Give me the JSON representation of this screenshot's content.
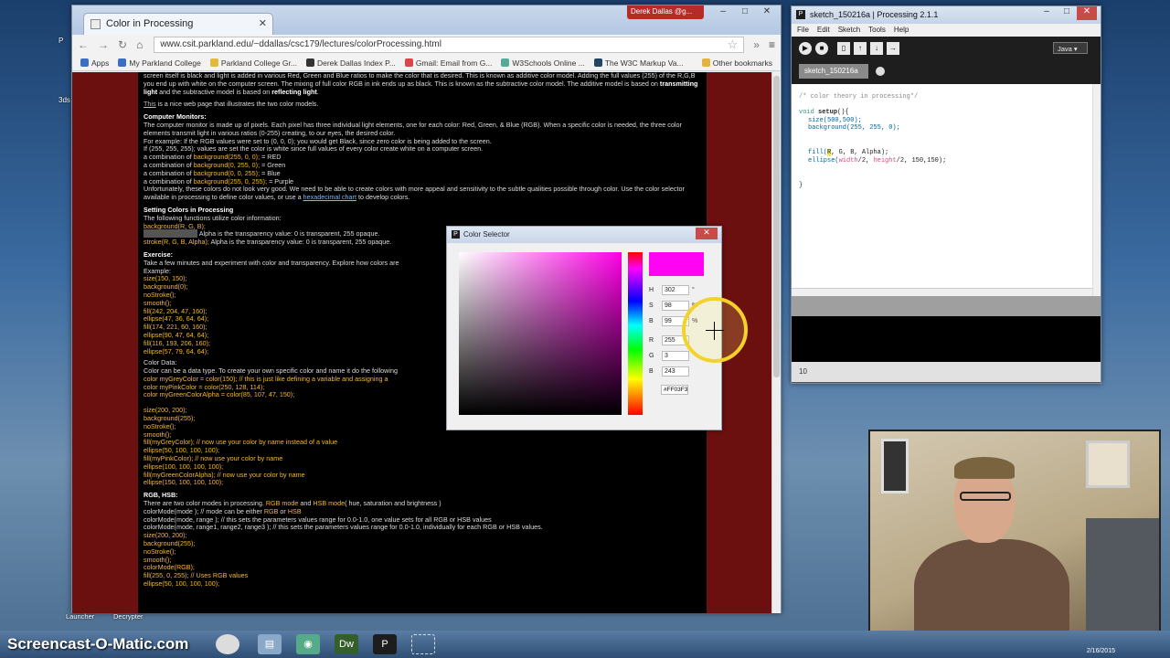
{
  "browser": {
    "tab_title": "Color in Processing",
    "user_chip": "Derek Dallas @g...",
    "url": "www.csit.parkland.edu/~ddallas/csc179/lectures/colorProcessing.html",
    "bookmarks": [
      "Apps",
      "My Parkland College",
      "Parkland College Gr...",
      "Derek Dallas Index P...",
      "Gmail: Email from G...",
      "W3Schools Online ...",
      "The W3C Markup Va..."
    ],
    "other_bookmarks": "Other bookmarks"
  },
  "page": {
    "intro1": "screen itself is black and light is added in various Red, Green and Blue ratios to make the color that is desired. This is known as additive color model. Adding the full values (255) of the R,G,B you end up with white on the computer screen. The mixing of full color RGB in ink ends up as black. This is known as the subtractive color model. The additive model is based on",
    "intro_b1": "transmitting light",
    "intro_mid": "and the subtractive model is based on",
    "intro_b2": "reflecting light",
    "nice_link": "This",
    "nice_text": "is a nice web page that illustrates the two color models.",
    "monitors_h": "Computer Monitors:",
    "monitors_1": "The computer monitor is made up of pixels. Each pixel has three individual light elements, one for each color: Red, Green, & Blue (RGB). When a specific color is needed, the three color elements transmit light in various ratios (0-255) creating, to our eyes, the desired color.",
    "monitors_2": "For example: If the RGB values were set to (0, 0, 0); you would get Black, since zero color is being added to the screen.",
    "monitors_3": "If (255, 255, 255); values are set the color is white since full values of every color create white on a computer screen.",
    "combos": [
      {
        "pre": "a combination of",
        "code": "background(255, 0, 0);",
        "post": "= RED"
      },
      {
        "pre": "a combination of",
        "code": "background(0, 255, 0);",
        "post": "= Green"
      },
      {
        "pre": "a combination of",
        "code": "background(0, 0, 255);",
        "post": "= Blue"
      },
      {
        "pre": "a combination of",
        "code": "background(255, 0, 255);",
        "post": "= Purple"
      }
    ],
    "unfortunately": "Unfortunately, these colors do not look very good. We need to be able to create colors with more appeal and sensitivity to the subtle qualities possible through color. Use the color selector available in processing to define color values, or use a",
    "hex_link": "hexadecimal chart",
    "unfortunately_end": "to develop colors.",
    "setting_h": "Setting Colors in Processing",
    "setting_1": "The following functions utilize color information:",
    "setting_code1": "background(R, G, B);",
    "setting_alpha": "Alpha is the transparency value: 0 is transparent, 255 opaque.",
    "setting_code2": "stroke(R, G, B, Alpha);",
    "setting_alpha2": "Alpha is the transparency value: 0 is transparent, 255 opaque.",
    "exercise_h": "Exercise:",
    "exercise_1": "Take a few minutes and experiment with color and transparency. Explore how colors are",
    "example": "Example:",
    "ex_code": [
      "size(150, 150);",
      "background(0);",
      "noStroke();",
      "smooth();",
      "fill(242, 204, 47, 160);",
      "ellipse(47, 36, 64, 64);",
      "fill(174, 221, 60, 160);",
      "ellipse(90, 47, 64, 64);",
      "fill(116, 193, 206, 160);",
      "ellipse(57, 79, 64, 64);"
    ],
    "colordata_h": "Color Data:",
    "colordata_1": "Color can be a data type. To create your own specific color and name it do the following",
    "cd_code1": "color myGreyColor = color(150); // this is just like defining a variable and assigning a",
    "cd_code2": "color myPinkColor = color(250, 128, 114);",
    "cd_code3": "color myGreenColorAlpha = color(85, 107, 47, 150);",
    "cd_code": [
      "size(200, 200);",
      "background(255);",
      "noStroke();",
      "smooth();",
      "fill(myGreyColor); // now use your color by name instead of a value",
      "ellipse(50, 100, 100, 100);",
      "fill(myPinkColor); // now use your color by name",
      "ellipse(100, 100, 100, 100);",
      "fill(myGreenColorAlpha); // now use your color by name",
      "ellipse(150, 100, 100, 100);"
    ],
    "rgbhsb_h": "RGB, HSB:",
    "rgbhsb_1": "There are two color modes in processing.",
    "rgb_mode": "RGB mode",
    "and": "and",
    "hsb_mode": "HSB mode",
    "hsb_paren": "( hue, saturation and brightness )",
    "cm_1": "colorMode(mode ); // mode can be either",
    "cm_rgb": "RGB",
    "cm_or": "or",
    "cm_hsb": "HSB",
    "cm_2": "colorMode(mode, range ); // this sets the parameters values range for 0.0-1.0, one value sets for all RGB or HSB values",
    "cm_3": "colorMode(mode, range1, range2, range3 ); // this sets the parameters values range for 0.0-1.0, individually for each RGB or HSB values.",
    "rh_code": [
      "size(200, 200);",
      "background(255);",
      "noStroke();",
      "smooth();",
      "colorMode(RGB);",
      "fill(255, 0, 255); // Uses RGB values",
      "ellipse(50, 100, 100, 100);"
    ]
  },
  "color_selector": {
    "title": "Color Selector",
    "fields": [
      {
        "label": "H",
        "value": "302",
        "unit": "°"
      },
      {
        "label": "S",
        "value": "98",
        "unit": "%"
      },
      {
        "label": "B",
        "value": "99",
        "unit": "%"
      },
      {
        "label": "R",
        "value": "255",
        "unit": ""
      },
      {
        "label": "G",
        "value": "3",
        "unit": ""
      },
      {
        "label": "B",
        "value": "243",
        "unit": ""
      }
    ],
    "hex": "#FF03F3",
    "swatch_color": "#ff03f3"
  },
  "processing": {
    "title": "sketch_150216a | Processing 2.1.1",
    "menus": [
      "File",
      "Edit",
      "Sketch",
      "Tools",
      "Help"
    ],
    "mode": "Java ▾",
    "tab": "sketch_150216a",
    "code_comment": "/* color theory in processing*/",
    "code_void": "void",
    "code_setup": "setup",
    "code_setup_rest": "(){",
    "code_size": "size(500,500);",
    "code_bg": "background(255, 255, 0);",
    "code_fill_a": "fill(",
    "code_fill_b": "R",
    "code_fill_c": ", G, B, Alpha);",
    "code_ell_a": "ellipse(",
    "code_ell_w": "width",
    "code_ell_m": "/2, ",
    "code_ell_h": "height",
    "code_ell_e": "/2, 150,150);",
    "code_close": "}",
    "line_number": "10"
  },
  "desktop": {
    "launcher": "Launcher",
    "decrypter": "Decrypter",
    "watermark": "Screencast-O-Matic.com",
    "clock_date": "2/16/2015"
  }
}
